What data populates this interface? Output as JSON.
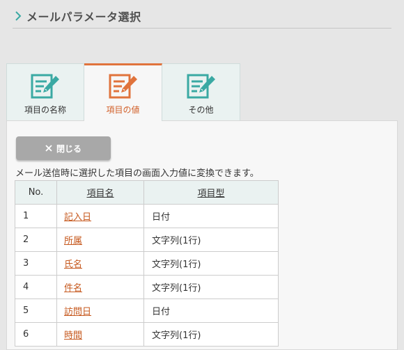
{
  "header": {
    "title": "メールパラメータ選択"
  },
  "tabs": [
    {
      "label": "項目の名称",
      "icon": "edit-note-icon",
      "active": false
    },
    {
      "label": "項目の値",
      "icon": "edit-note-icon",
      "active": true
    },
    {
      "label": "その他",
      "icon": "edit-note-icon",
      "active": false
    }
  ],
  "colors": {
    "accent": "#e0733c",
    "teal": "#3aa9a3",
    "link": "#c6581d"
  },
  "close_button": {
    "label": "閉じる",
    "icon": "close-icon"
  },
  "description": "メール送信時に選択した項目の画面入力値に変換できます。",
  "table": {
    "headers": {
      "no": "No.",
      "name": "項目名",
      "type": "項目型"
    },
    "rows": [
      {
        "no": "1",
        "name": "記入日",
        "type": "日付"
      },
      {
        "no": "2",
        "name": "所属",
        "type": "文字列(1行)"
      },
      {
        "no": "3",
        "name": "氏名",
        "type": "文字列(1行)"
      },
      {
        "no": "4",
        "name": "件名",
        "type": "文字列(1行)"
      },
      {
        "no": "5",
        "name": "訪問日",
        "type": "日付"
      },
      {
        "no": "6",
        "name": "時間",
        "type": "文字列(1行)"
      }
    ]
  }
}
